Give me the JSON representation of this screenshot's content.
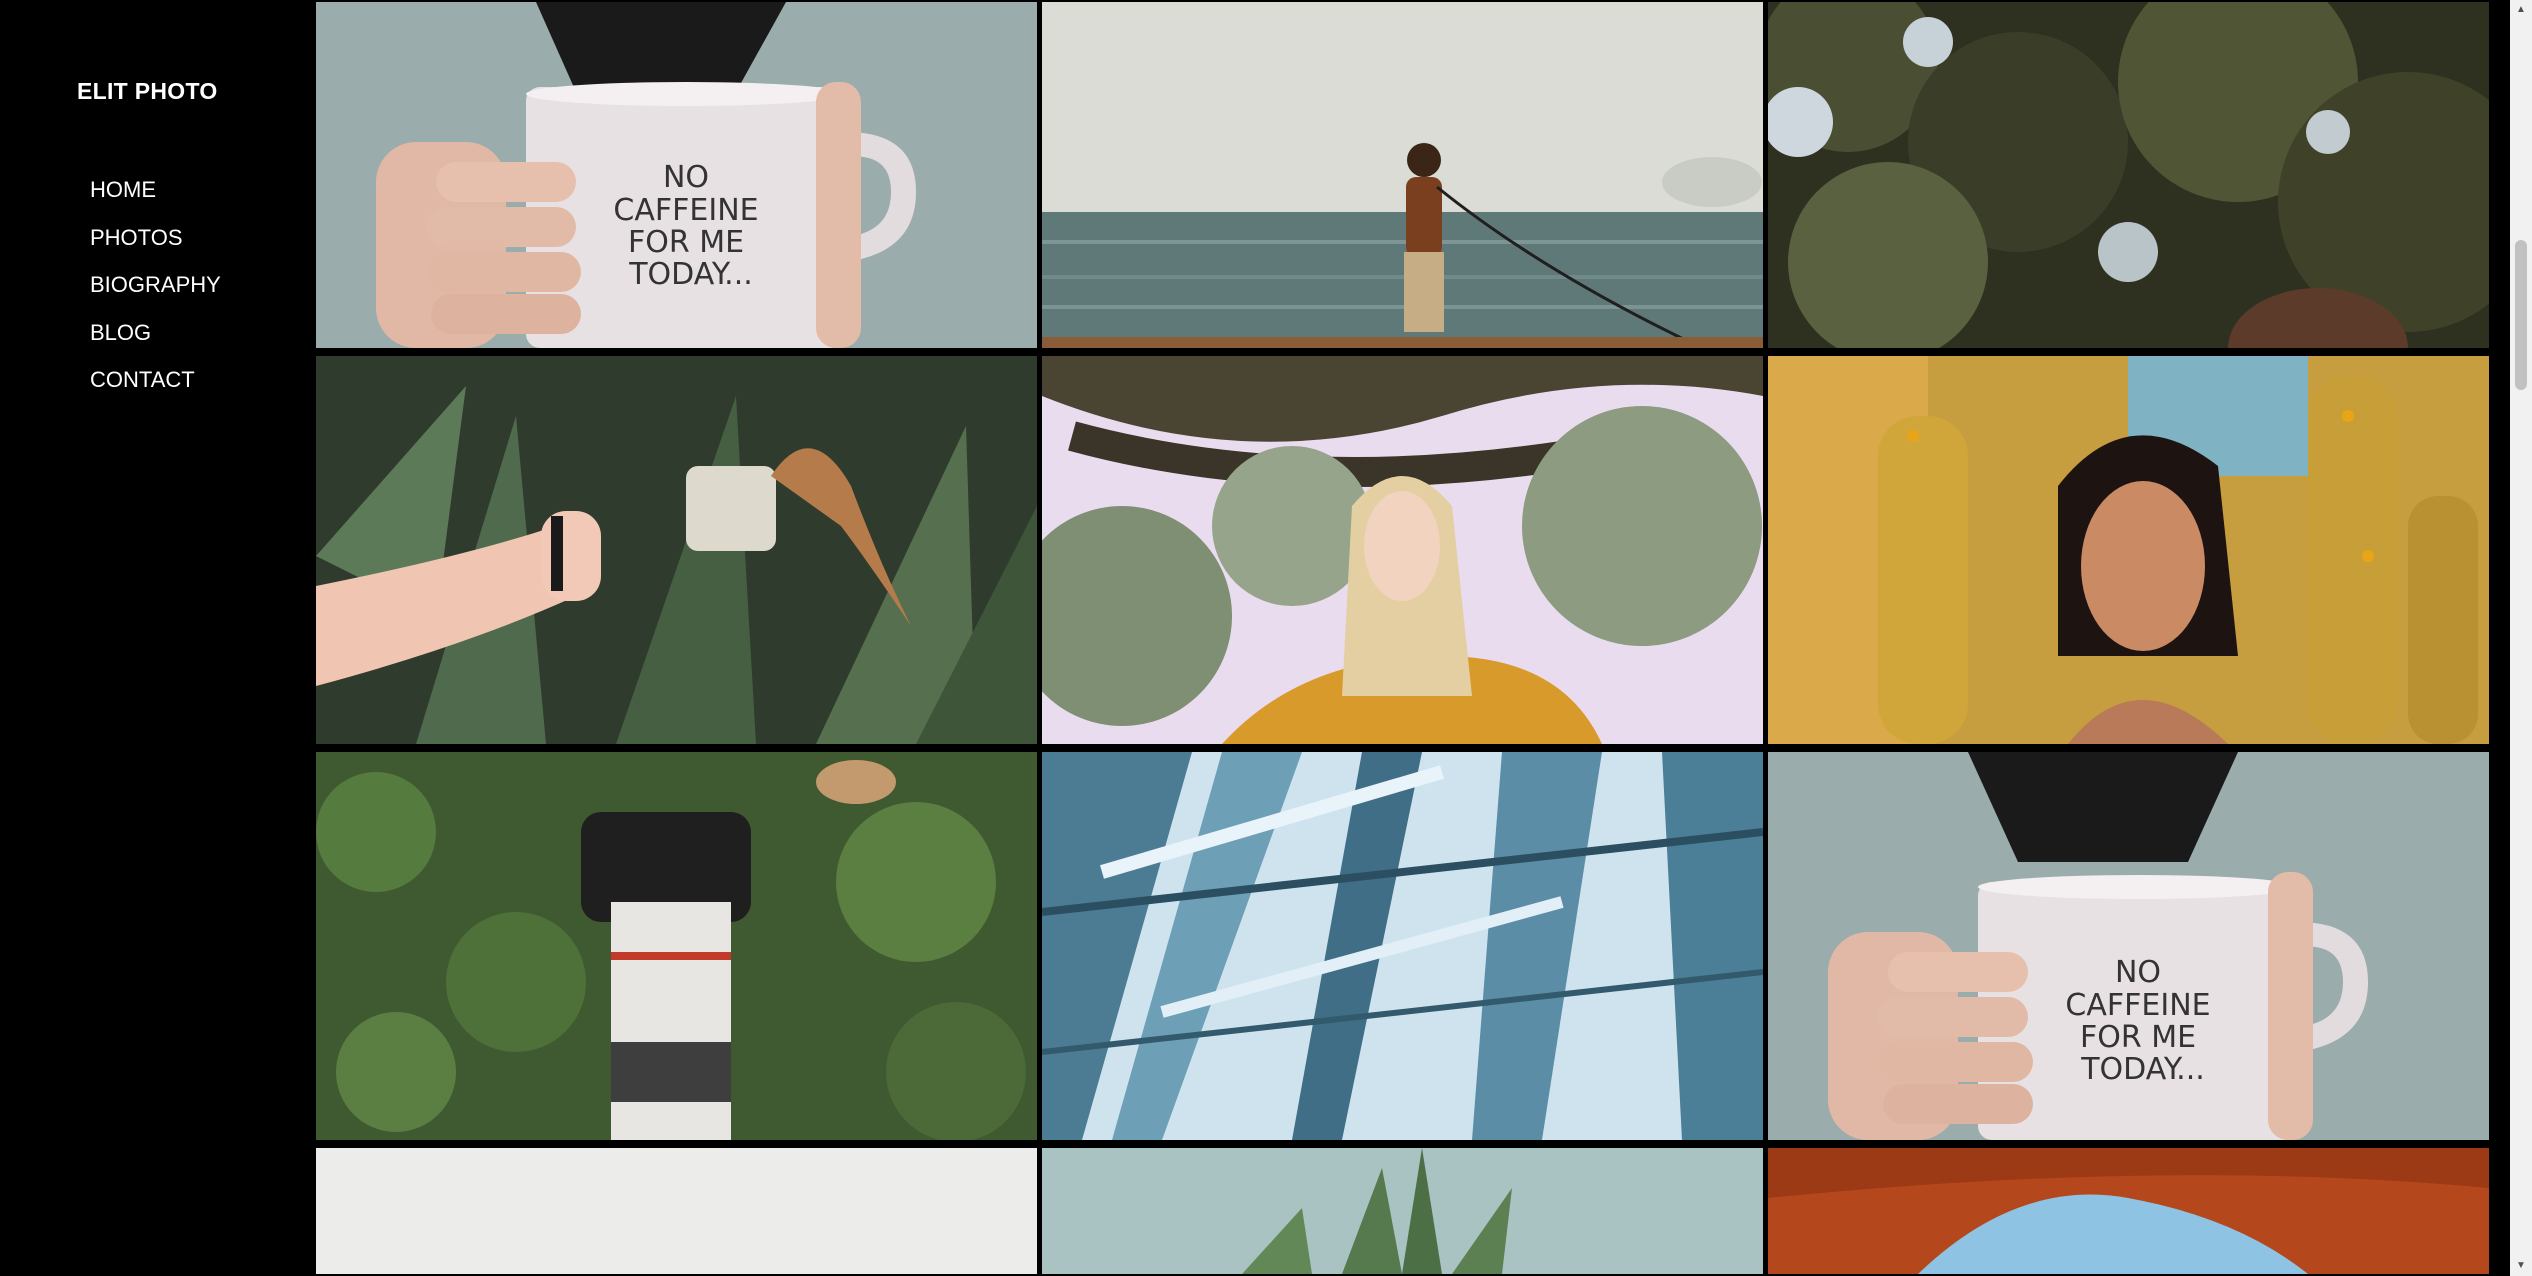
{
  "sidebar": {
    "brand": "ELIT PHOTO",
    "nav": [
      {
        "label": "HOME"
      },
      {
        "label": "PHOTOS"
      },
      {
        "label": "BIOGRAPHY"
      },
      {
        "label": "BLOG"
      },
      {
        "label": "CONTACT"
      }
    ]
  },
  "gallery": {
    "mug_text_lines": [
      "NO",
      "CAFFEINE",
      "FOR ME",
      "TODAY..."
    ]
  },
  "colors": {
    "background": "#000000",
    "text": "#ffffff",
    "scrollbar_track": "#f1f1f1",
    "scrollbar_thumb": "#c1c1c1"
  }
}
